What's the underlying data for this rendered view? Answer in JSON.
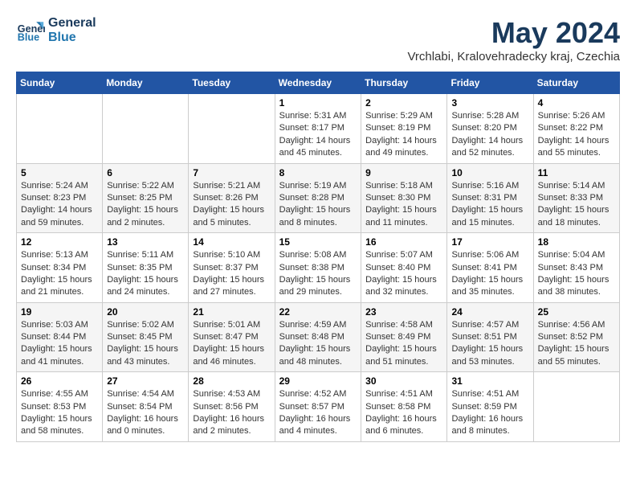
{
  "logo": {
    "line1": "General",
    "line2": "Blue"
  },
  "title": "May 2024",
  "location": "Vrchlabi, Kralovehradecky kraj, Czechia",
  "weekdays": [
    "Sunday",
    "Monday",
    "Tuesday",
    "Wednesday",
    "Thursday",
    "Friday",
    "Saturday"
  ],
  "weeks": [
    [
      {
        "day": "",
        "info": ""
      },
      {
        "day": "",
        "info": ""
      },
      {
        "day": "",
        "info": ""
      },
      {
        "day": "1",
        "info": "Sunrise: 5:31 AM\nSunset: 8:17 PM\nDaylight: 14 hours\nand 45 minutes."
      },
      {
        "day": "2",
        "info": "Sunrise: 5:29 AM\nSunset: 8:19 PM\nDaylight: 14 hours\nand 49 minutes."
      },
      {
        "day": "3",
        "info": "Sunrise: 5:28 AM\nSunset: 8:20 PM\nDaylight: 14 hours\nand 52 minutes."
      },
      {
        "day": "4",
        "info": "Sunrise: 5:26 AM\nSunset: 8:22 PM\nDaylight: 14 hours\nand 55 minutes."
      }
    ],
    [
      {
        "day": "5",
        "info": "Sunrise: 5:24 AM\nSunset: 8:23 PM\nDaylight: 14 hours\nand 59 minutes."
      },
      {
        "day": "6",
        "info": "Sunrise: 5:22 AM\nSunset: 8:25 PM\nDaylight: 15 hours\nand 2 minutes."
      },
      {
        "day": "7",
        "info": "Sunrise: 5:21 AM\nSunset: 8:26 PM\nDaylight: 15 hours\nand 5 minutes."
      },
      {
        "day": "8",
        "info": "Sunrise: 5:19 AM\nSunset: 8:28 PM\nDaylight: 15 hours\nand 8 minutes."
      },
      {
        "day": "9",
        "info": "Sunrise: 5:18 AM\nSunset: 8:30 PM\nDaylight: 15 hours\nand 11 minutes."
      },
      {
        "day": "10",
        "info": "Sunrise: 5:16 AM\nSunset: 8:31 PM\nDaylight: 15 hours\nand 15 minutes."
      },
      {
        "day": "11",
        "info": "Sunrise: 5:14 AM\nSunset: 8:33 PM\nDaylight: 15 hours\nand 18 minutes."
      }
    ],
    [
      {
        "day": "12",
        "info": "Sunrise: 5:13 AM\nSunset: 8:34 PM\nDaylight: 15 hours\nand 21 minutes."
      },
      {
        "day": "13",
        "info": "Sunrise: 5:11 AM\nSunset: 8:35 PM\nDaylight: 15 hours\nand 24 minutes."
      },
      {
        "day": "14",
        "info": "Sunrise: 5:10 AM\nSunset: 8:37 PM\nDaylight: 15 hours\nand 27 minutes."
      },
      {
        "day": "15",
        "info": "Sunrise: 5:08 AM\nSunset: 8:38 PM\nDaylight: 15 hours\nand 29 minutes."
      },
      {
        "day": "16",
        "info": "Sunrise: 5:07 AM\nSunset: 8:40 PM\nDaylight: 15 hours\nand 32 minutes."
      },
      {
        "day": "17",
        "info": "Sunrise: 5:06 AM\nSunset: 8:41 PM\nDaylight: 15 hours\nand 35 minutes."
      },
      {
        "day": "18",
        "info": "Sunrise: 5:04 AM\nSunset: 8:43 PM\nDaylight: 15 hours\nand 38 minutes."
      }
    ],
    [
      {
        "day": "19",
        "info": "Sunrise: 5:03 AM\nSunset: 8:44 PM\nDaylight: 15 hours\nand 41 minutes."
      },
      {
        "day": "20",
        "info": "Sunrise: 5:02 AM\nSunset: 8:45 PM\nDaylight: 15 hours\nand 43 minutes."
      },
      {
        "day": "21",
        "info": "Sunrise: 5:01 AM\nSunset: 8:47 PM\nDaylight: 15 hours\nand 46 minutes."
      },
      {
        "day": "22",
        "info": "Sunrise: 4:59 AM\nSunset: 8:48 PM\nDaylight: 15 hours\nand 48 minutes."
      },
      {
        "day": "23",
        "info": "Sunrise: 4:58 AM\nSunset: 8:49 PM\nDaylight: 15 hours\nand 51 minutes."
      },
      {
        "day": "24",
        "info": "Sunrise: 4:57 AM\nSunset: 8:51 PM\nDaylight: 15 hours\nand 53 minutes."
      },
      {
        "day": "25",
        "info": "Sunrise: 4:56 AM\nSunset: 8:52 PM\nDaylight: 15 hours\nand 55 minutes."
      }
    ],
    [
      {
        "day": "26",
        "info": "Sunrise: 4:55 AM\nSunset: 8:53 PM\nDaylight: 15 hours\nand 58 minutes."
      },
      {
        "day": "27",
        "info": "Sunrise: 4:54 AM\nSunset: 8:54 PM\nDaylight: 16 hours\nand 0 minutes."
      },
      {
        "day": "28",
        "info": "Sunrise: 4:53 AM\nSunset: 8:56 PM\nDaylight: 16 hours\nand 2 minutes."
      },
      {
        "day": "29",
        "info": "Sunrise: 4:52 AM\nSunset: 8:57 PM\nDaylight: 16 hours\nand 4 minutes."
      },
      {
        "day": "30",
        "info": "Sunrise: 4:51 AM\nSunset: 8:58 PM\nDaylight: 16 hours\nand 6 minutes."
      },
      {
        "day": "31",
        "info": "Sunrise: 4:51 AM\nSunset: 8:59 PM\nDaylight: 16 hours\nand 8 minutes."
      },
      {
        "day": "",
        "info": ""
      }
    ]
  ]
}
